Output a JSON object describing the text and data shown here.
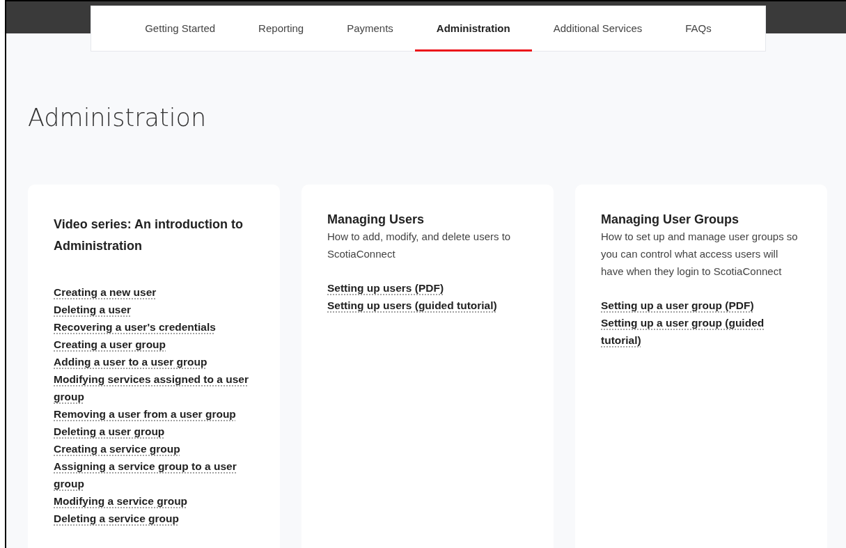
{
  "nav": {
    "tabs": [
      {
        "label": "Getting Started",
        "selected": false
      },
      {
        "label": "Reporting",
        "selected": false
      },
      {
        "label": "Payments",
        "selected": false
      },
      {
        "label": "Administration",
        "selected": true
      },
      {
        "label": "Additional Services",
        "selected": false
      },
      {
        "label": "FAQs",
        "selected": false
      }
    ]
  },
  "page_title": "Administration",
  "cards": [
    {
      "title": "Video series: An introduction to Administration",
      "links": [
        "Creating a new user",
        "Deleting a user",
        "Recovering a user's credentials",
        "Creating a user group",
        "Adding a user to a user group",
        "Modifying services assigned to a user group",
        "Removing a user from a user group",
        "Deleting a user group",
        "Creating a service group",
        "Assigning a service group to a user group",
        "Modifying a service group",
        "Deleting a service group"
      ]
    },
    {
      "title": "Managing Users",
      "description": "How to add, modify, and delete users to ScotiaConnect",
      "links": [
        "Setting up users (PDF)",
        "Setting up users (guided tutorial)"
      ]
    },
    {
      "title": "Managing User Groups",
      "description": "How to set up and manage user groups so you can control what access users will have when they login to ScotiaConnect",
      "links": [
        "Setting up a user group (PDF)",
        "Setting up a user group (guided tutorial)"
      ]
    }
  ]
}
